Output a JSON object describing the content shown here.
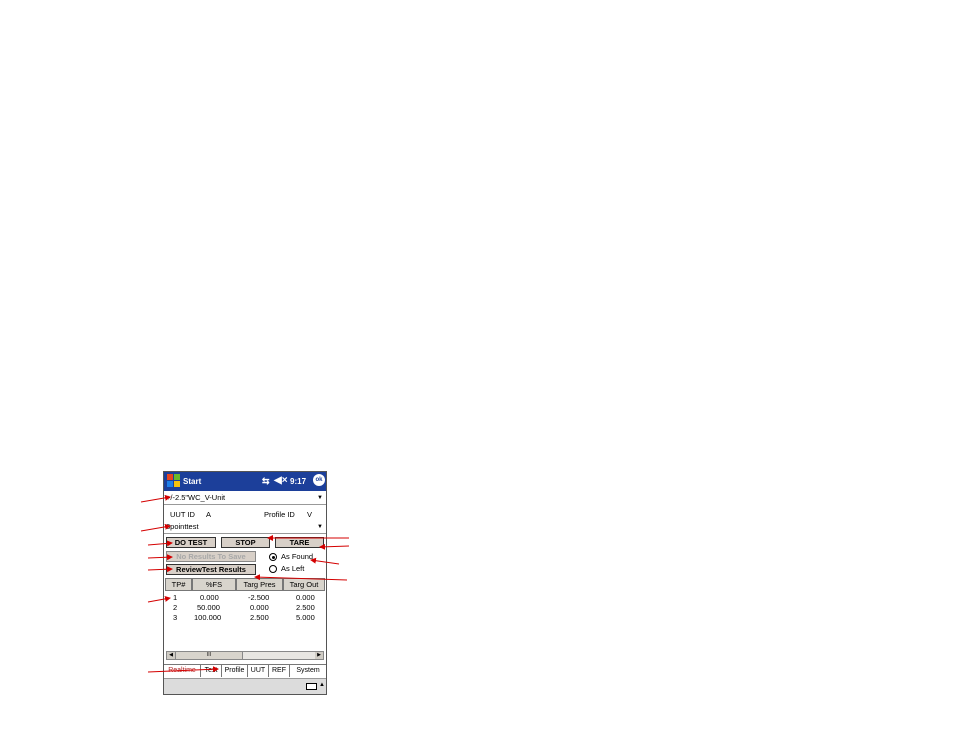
{
  "titlebar": {
    "title": "Start",
    "time": "9:17",
    "ok_label": "ok",
    "color": "#1c3f9a"
  },
  "unit_combo": {
    "value": "+/-2.5\"WC_V-Unit"
  },
  "ids": {
    "uut_label": "UUT ID",
    "uut_value": "A",
    "profile_label": "Profile ID",
    "profile_value": "V"
  },
  "profile_combo": {
    "value": "3pointtest"
  },
  "buttons": {
    "do_test": "DO TEST",
    "stop": "STOP",
    "tare": "TARE",
    "no_results": "No Results To Save",
    "review": "ReviewTest Results"
  },
  "radios": {
    "as_found": "As Found",
    "as_left": "As Left",
    "selected": "as_found"
  },
  "table": {
    "headers": [
      "TP#",
      "%FS",
      "Targ Pres",
      "Targ Out"
    ],
    "rows": [
      [
        "1",
        "0.000",
        "-2.500",
        "0.000"
      ],
      [
        "2",
        "50.000",
        "0.000",
        "2.500"
      ],
      [
        "3",
        "100.000",
        "2.500",
        "5.000"
      ]
    ]
  },
  "scrollbar": {
    "thumb_label": "III"
  },
  "tabs": [
    "Realtime",
    "Test",
    "Profile",
    "UUT",
    "REF",
    "System"
  ],
  "active_tab": "Realtime",
  "annotation_color": "#d40000"
}
